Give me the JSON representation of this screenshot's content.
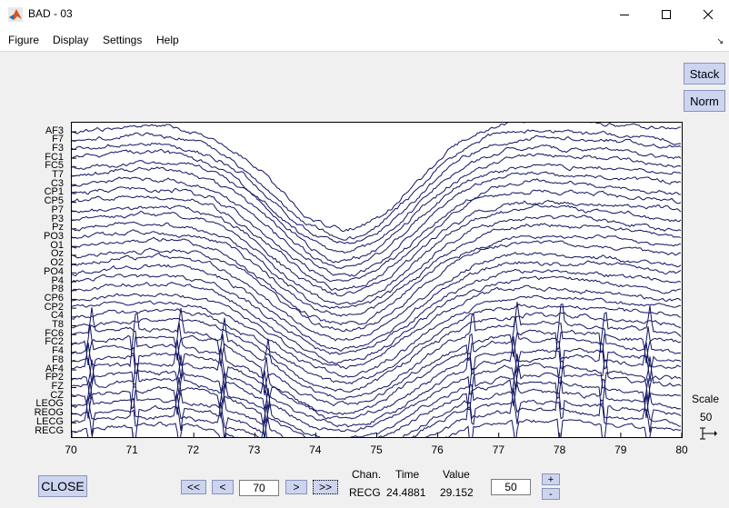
{
  "window": {
    "title": "BAD - 03"
  },
  "menu": [
    "Figure",
    "Display",
    "Settings",
    "Help"
  ],
  "buttons": {
    "stack": "Stack",
    "norm": "Norm",
    "close": "CLOSE",
    "prev_page": "<<",
    "prev": "<",
    "next": ">",
    "next_page": ">>",
    "scale_up": "+",
    "scale_down": "-"
  },
  "channels": [
    "AF3",
    "F7",
    "F3",
    "FC1",
    "FC5",
    "T7",
    "C3",
    "CP1",
    "CP5",
    "P7",
    "P3",
    "Pz",
    "PO3",
    "O1",
    "Oz",
    "O2",
    "PO4",
    "P4",
    "P8",
    "CP6",
    "CP2",
    "C4",
    "T8",
    "FC6",
    "FC2",
    "F4",
    "F8",
    "AF4",
    "FP2",
    "FZ",
    "CZ",
    "LEOG",
    "REOG",
    "LECG",
    "RECG"
  ],
  "xaxis": {
    "ticks": [
      "70",
      "71",
      "72",
      "73",
      "74",
      "75",
      "76",
      "77",
      "78",
      "79",
      "80"
    ],
    "min": 70,
    "max": 80
  },
  "time_field": "70",
  "scale": {
    "label": "Scale",
    "value": "50"
  },
  "info": {
    "chan_label": "Chan.",
    "time_label": "Time",
    "value_label": "Value",
    "chan": "RECG",
    "time": "24.4881",
    "value": "29.152"
  },
  "scale_field": "50",
  "colors": {
    "trace": "#0f1361",
    "button": "#ccd4f0"
  }
}
